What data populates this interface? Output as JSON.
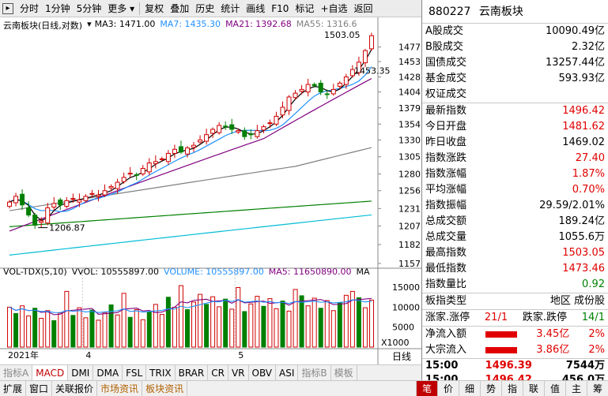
{
  "toolbar": {
    "items": [
      "分时",
      "1分钟",
      "5分钟",
      "更多",
      "复权",
      "叠加",
      "历史",
      "统计",
      "画线",
      "F10",
      "标记",
      "+自选",
      "返回"
    ]
  },
  "chart": {
    "title": "云南板块(日线,对数)",
    "ma_legend": [
      {
        "label": "MA3: 1471.00",
        "color": "#000000"
      },
      {
        "label": "MA7: 1435.30",
        "color": "#1e90ff"
      },
      {
        "label": "MA21: 1392.68",
        "color": "#800080"
      },
      {
        "label": "MA55: 1316.6",
        "color": "#808080"
      }
    ],
    "price_axis": [
      "1477",
      "1453",
      "1428",
      "1404",
      "1379",
      "1354",
      "1330",
      "1305",
      "1280",
      "1256",
      "1231",
      "1207",
      "1182",
      "1157"
    ],
    "high_label": "1503.05",
    "mid_label": "1453.35",
    "low_label": "1206.87",
    "date_labels": [
      "2021年",
      "4",
      "5"
    ],
    "vol_legend": [
      {
        "label": "VOL-TDX(5,10)",
        "color": "#000000"
      },
      {
        "label": "VVOL: 10555897.00",
        "color": "#000000"
      },
      {
        "label": "VOLUME: 10555897.00",
        "color": "#1e90ff"
      },
      {
        "label": "MA5: 11650890.00",
        "color": "#800080"
      },
      {
        "label": "MA",
        "color": "#000000"
      }
    ],
    "vol_axis": [
      "15000",
      "10000",
      "5000",
      "X1000"
    ],
    "period_label": "日线"
  },
  "chart_data": {
    "type": "candlestick",
    "title": "云南板块(日线,对数)",
    "ma": {
      "MA3": 1471.0,
      "MA7": 1435.3,
      "MA21": 1392.68,
      "MA55": 1316.6
    },
    "highest": 1503.05,
    "lowest": 1206.87,
    "ylim": [
      1157,
      1503
    ],
    "volume_unit": "X1000",
    "volume_last": 10555897.0,
    "volume_ma5": 11650890.0
  },
  "indicator_tabs": [
    "指标A",
    "MACD",
    "DMI",
    "DMA",
    "FSL",
    "TRIX",
    "BRAR",
    "CR",
    "VR",
    "OBV",
    "ASI",
    "指标B",
    "模板"
  ],
  "bottom_tabs": [
    "扩展",
    "窗口",
    "关联报价",
    "市场资讯",
    "板块资讯"
  ],
  "bottom_right_tabs": [
    "笔",
    "价",
    "细",
    "势",
    "指",
    "联",
    "值",
    "主",
    "筹"
  ],
  "panel": {
    "code": "880227",
    "name": "云南板块",
    "rows1": [
      {
        "label": "A股成交",
        "value": "10090.49亿"
      },
      {
        "label": "B股成交",
        "value": "2.32亿"
      },
      {
        "label": "国债成交",
        "value": "13257.44亿"
      },
      {
        "label": "基金成交",
        "value": "593.93亿"
      },
      {
        "label": "权证成交",
        "value": ""
      }
    ],
    "rows2": [
      {
        "label": "最新指数",
        "value": "1496.42",
        "color": "red"
      },
      {
        "label": "今日开盘",
        "value": "1481.62",
        "color": "red"
      },
      {
        "label": "昨日收盘",
        "value": "1469.02",
        "color": ""
      },
      {
        "label": "指数涨跌",
        "value": "27.40",
        "color": "red"
      },
      {
        "label": "指数涨幅",
        "value": "1.87%",
        "color": "red"
      },
      {
        "label": "平均涨幅",
        "value": "0.70%",
        "color": "red"
      },
      {
        "label": "指数振幅",
        "value": "29.59/2.01%",
        "color": ""
      },
      {
        "label": "总成交额",
        "value": "189.24亿",
        "color": ""
      },
      {
        "label": "总成交量",
        "value": "1055.6万",
        "color": ""
      },
      {
        "label": "最高指数",
        "value": "1503.05",
        "color": "red"
      },
      {
        "label": "最低指数",
        "value": "1473.46",
        "color": "red"
      },
      {
        "label": "指数量比",
        "value": "0.92",
        "color": "green"
      }
    ],
    "board_type_label": "板指类型",
    "board_type_value": "地区 成份股",
    "rise_fall": {
      "label1": "涨家.涨停",
      "val1": "21/1",
      "label2": "跌家.跌停",
      "val2": "14/1"
    },
    "flows": [
      {
        "label": "净流入额",
        "value": "3.45亿",
        "pct": "2%"
      },
      {
        "label": "大宗流入",
        "value": "3.86亿",
        "pct": "2%"
      }
    ],
    "ticks": [
      {
        "time": "15:00",
        "price": "1496.39",
        "vol": "7544万"
      },
      {
        "time": "15:00",
        "price": "1496.42",
        "vol": "456.0万"
      }
    ]
  }
}
